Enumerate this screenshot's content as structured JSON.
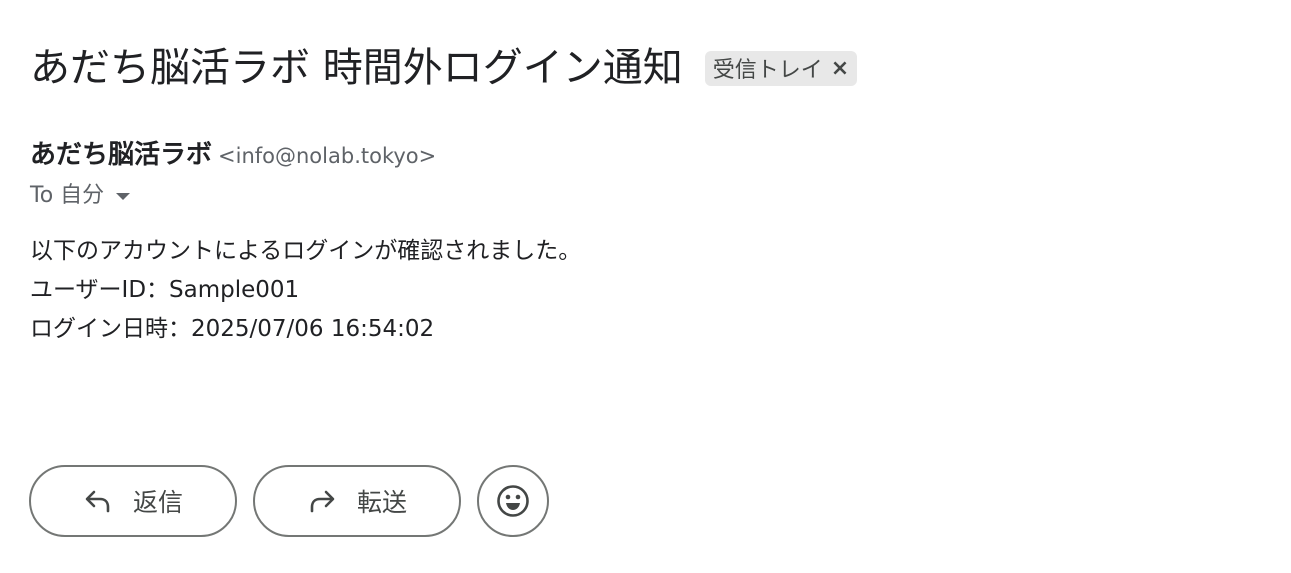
{
  "email": {
    "subject": "あだち脳活ラボ  時間外ログイン通知",
    "label_chip": {
      "text": "受信トレイ",
      "close": "×"
    },
    "sender": {
      "name": "あだち脳活ラボ",
      "email": "<info@nolab.tokyo>"
    },
    "to_label": "To 自分",
    "body_lines": [
      "以下のアカウントによるログインが確認されました。",
      "ユーザーID：Sample001",
      "ログイン日時：2025/07/06 16:54:02"
    ]
  },
  "actions": {
    "reply_label": "返信",
    "forward_label": "転送",
    "reply_icon": "reply-arrow-icon",
    "forward_icon": "forward-arrow-icon",
    "emoji_icon": "smiley-icon"
  },
  "colors": {
    "text": "#202124",
    "secondary_text": "#5f6368",
    "chip_bg": "#e8e8e8",
    "button_border": "#747775"
  }
}
